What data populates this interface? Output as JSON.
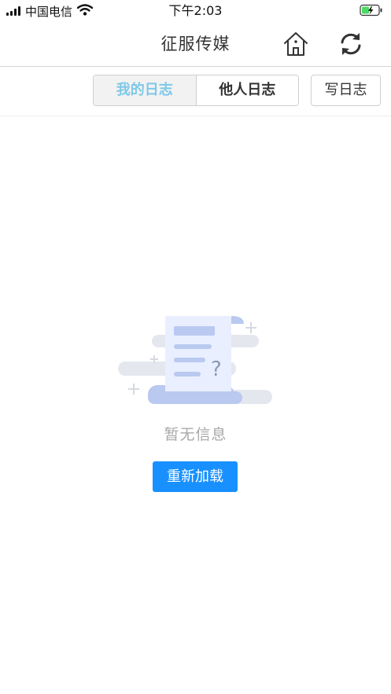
{
  "status_bar": {
    "carrier": "中国电信",
    "time": "下午2:03",
    "icons": [
      "signal-icon",
      "wifi-icon",
      "battery-charging-icon"
    ]
  },
  "header": {
    "title": "征服传媒",
    "icons": [
      "home-icon",
      "refresh-icon"
    ]
  },
  "tabs": {
    "items": [
      {
        "label": "我的日志",
        "active": true
      },
      {
        "label": "他人日志",
        "active": false
      }
    ],
    "write_label": "写日志"
  },
  "empty_state": {
    "message": "暂无信息",
    "reload_label": "重新加载",
    "icon": "empty-document-icon"
  },
  "colors": {
    "accent": "#1890ff",
    "active_tab_text": "#7ec8e8",
    "battery_green": "#4cd964"
  }
}
